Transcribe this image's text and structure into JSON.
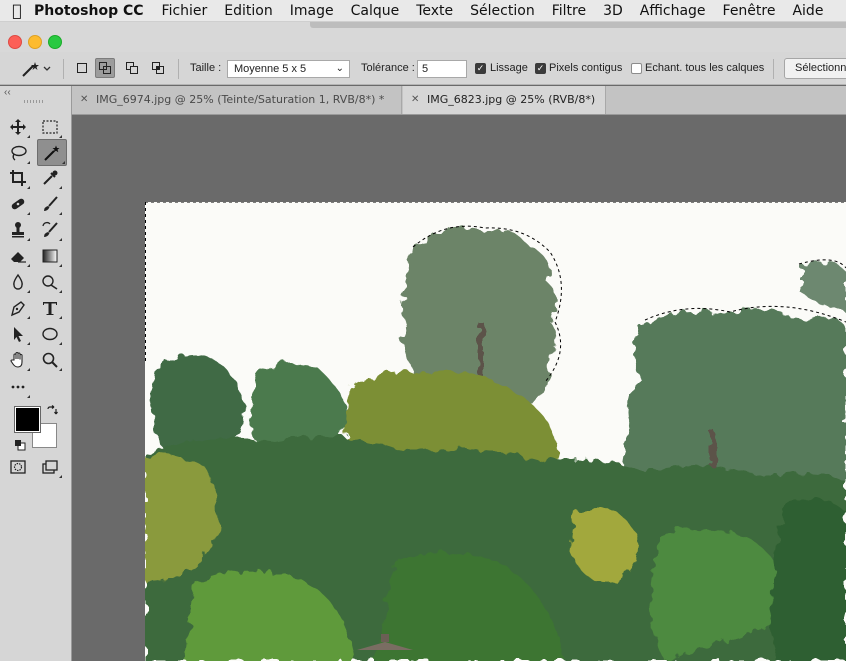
{
  "menubar": {
    "app_name": "Photoshop CC",
    "items": [
      "Fichier",
      "Edition",
      "Image",
      "Calque",
      "Texte",
      "Sélection",
      "Filtre",
      "3D",
      "Affichage",
      "Fenêtre",
      "Aide"
    ]
  },
  "options": {
    "size_label": "Taille :",
    "size_value": "Moyenne 5 x 5",
    "tolerance_label": "Tolérance :",
    "tolerance_value": "5",
    "antialias_label": "Lissage",
    "antialias_checked": true,
    "contiguous_label": "Pixels contigus",
    "contiguous_checked": true,
    "sample_all_label": "Echant. tous les calques",
    "sample_all_checked": false,
    "select_button": "Sélectionner"
  },
  "tabs": [
    {
      "label": "IMG_6974.jpg @ 25% (Teinte/Saturation 1, RVB/8*) *",
      "active": false
    },
    {
      "label": "IMG_6823.jpg @ 25% (RVB/8*)",
      "active": true
    }
  ],
  "tools": [
    "move-icon",
    "rect-marquee-icon",
    "lasso-icon",
    "magic-wand-icon",
    "crop-icon",
    "eyedropper-icon",
    "healing-icon",
    "brush-icon",
    "stamp-icon",
    "history-brush-icon",
    "eraser-icon",
    "gradient-icon",
    "blur-icon",
    "dodge-icon",
    "pen-icon",
    "type-icon",
    "path-select-icon",
    "ellipse-icon",
    "hand-icon",
    "zoom-icon",
    "more-tools-icon"
  ],
  "colors": {
    "foreground": "#000000",
    "background": "#ffffff",
    "canvas_bg": "#6a6a6a"
  }
}
